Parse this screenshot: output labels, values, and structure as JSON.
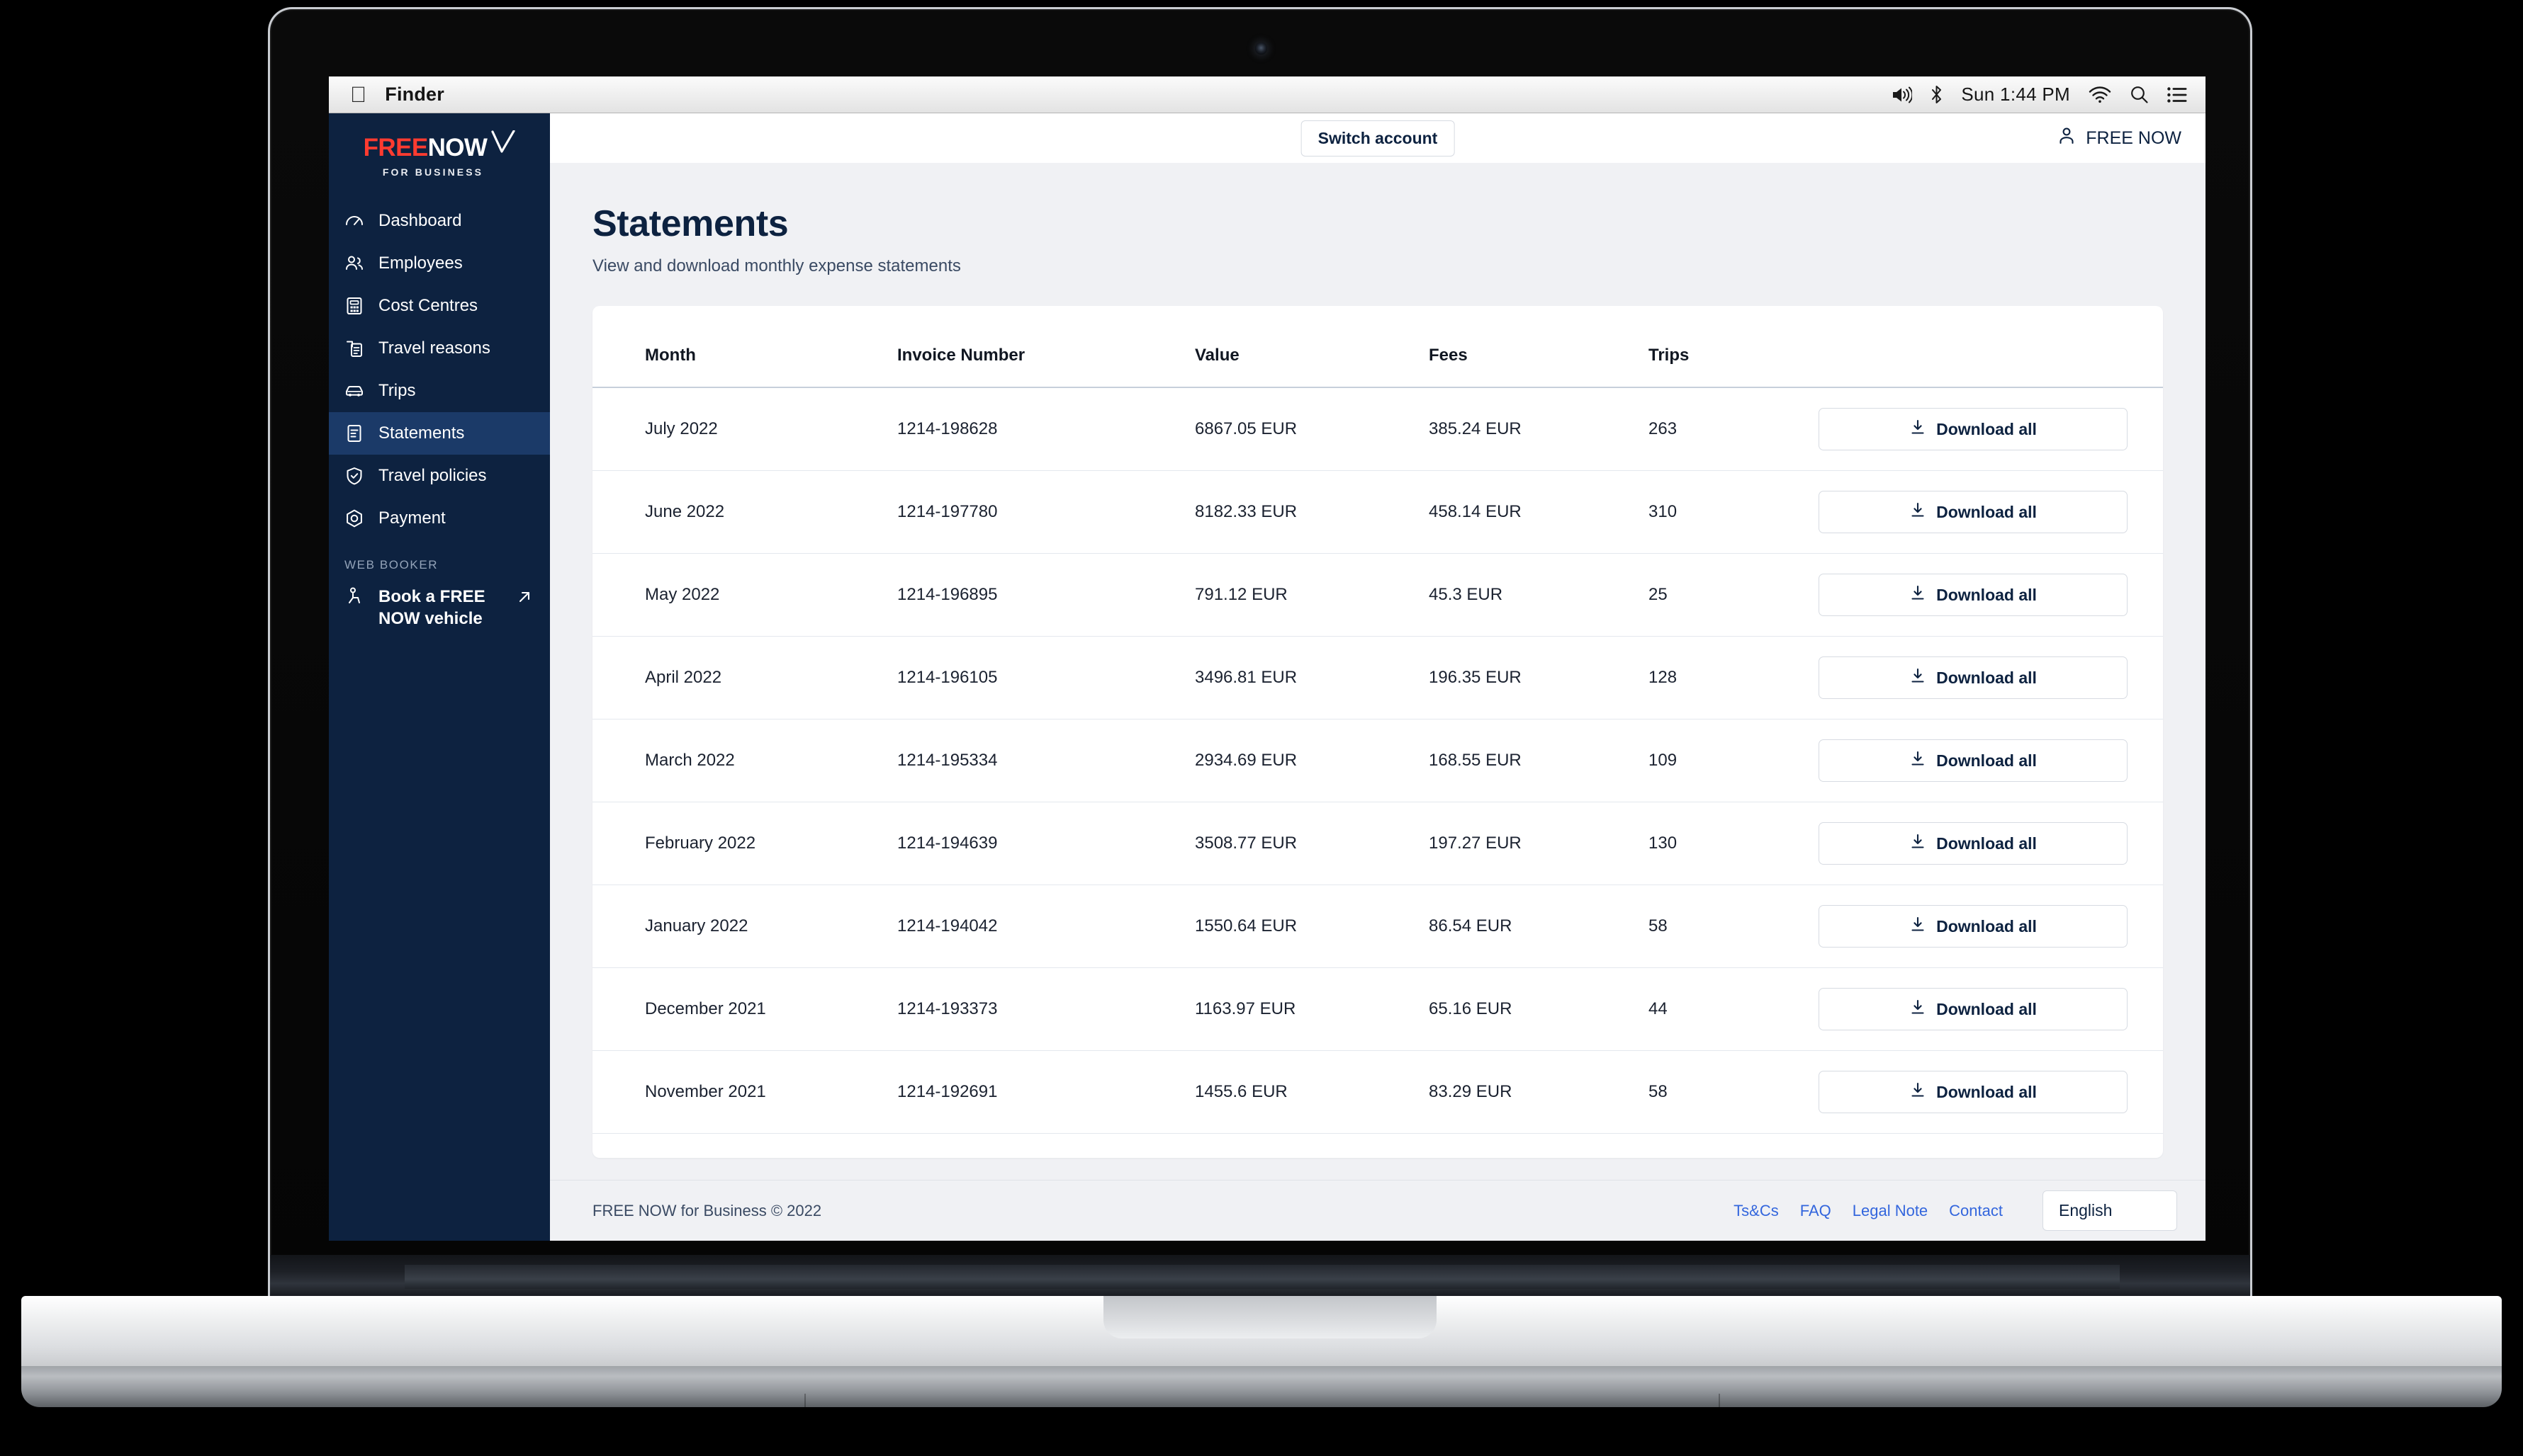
{
  "os_menubar": {
    "apple_icon": "apple-logo",
    "app_name": "Finder",
    "volume_icon": "volume-icon",
    "bluetooth_icon": "bluetooth-icon",
    "clock": "Sun 1:44 PM",
    "wifi_icon": "wifi-icon",
    "search_icon": "search-icon",
    "control_center_icon": "control-center-icon"
  },
  "sidebar": {
    "brand": {
      "free": "FREE",
      "now": "NOW",
      "tagline": "FOR BUSINESS"
    },
    "items": [
      {
        "label": "Dashboard",
        "icon": "speedometer-icon",
        "active": false
      },
      {
        "label": "Employees",
        "icon": "people-icon",
        "active": false
      },
      {
        "label": "Cost Centres",
        "icon": "building-icon",
        "active": false
      },
      {
        "label": "Travel reasons",
        "icon": "clipboard-icon",
        "active": false
      },
      {
        "label": "Trips",
        "icon": "car-icon",
        "active": false
      },
      {
        "label": "Statements",
        "icon": "document-icon",
        "active": true
      },
      {
        "label": "Travel policies",
        "icon": "shield-check-icon",
        "active": false
      },
      {
        "label": "Payment",
        "icon": "circle-target-icon",
        "active": false
      }
    ],
    "section_label": "WEB BOOKER",
    "booker": {
      "label": "Book a FREE NOW vehicle",
      "icon": "person-ride-icon",
      "external_icon": "external-link-icon"
    }
  },
  "topbar": {
    "switch_account_label": "Switch account",
    "account_name": "FREE NOW",
    "account_icon": "person-icon"
  },
  "main": {
    "title": "Statements",
    "subtitle": "View and download monthly expense statements",
    "table": {
      "columns": [
        "Month",
        "Invoice Number",
        "Value",
        "Fees",
        "Trips"
      ],
      "action_label": "Download all",
      "action_icon": "download-icon",
      "rows": [
        {
          "month": "July 2022",
          "invoice": "1214-198628",
          "value": "6867.05 EUR",
          "fees": "385.24 EUR",
          "trips": "263"
        },
        {
          "month": "June 2022",
          "invoice": "1214-197780",
          "value": "8182.33 EUR",
          "fees": "458.14 EUR",
          "trips": "310"
        },
        {
          "month": "May 2022",
          "invoice": "1214-196895",
          "value": "791.12 EUR",
          "fees": "45.3 EUR",
          "trips": "25"
        },
        {
          "month": "April 2022",
          "invoice": "1214-196105",
          "value": "3496.81 EUR",
          "fees": "196.35 EUR",
          "trips": "128"
        },
        {
          "month": "March 2022",
          "invoice": "1214-195334",
          "value": "2934.69 EUR",
          "fees": "168.55 EUR",
          "trips": "109"
        },
        {
          "month": "February 2022",
          "invoice": "1214-194639",
          "value": "3508.77 EUR",
          "fees": "197.27 EUR",
          "trips": "130"
        },
        {
          "month": "January 2022",
          "invoice": "1214-194042",
          "value": "1550.64 EUR",
          "fees": "86.54 EUR",
          "trips": "58"
        },
        {
          "month": "December 2021",
          "invoice": "1214-193373",
          "value": "1163.97 EUR",
          "fees": "65.16 EUR",
          "trips": "44"
        },
        {
          "month": "November 2021",
          "invoice": "1214-192691",
          "value": "1455.6 EUR",
          "fees": "83.29 EUR",
          "trips": "58"
        }
      ]
    }
  },
  "footer": {
    "copyright": "FREE NOW for Business © 2022",
    "links": [
      "Ts&Cs",
      "FAQ",
      "Legal Note",
      "Contact"
    ],
    "language": "English"
  },
  "colors": {
    "brand_red": "#ff3b30",
    "sidebar_navy": "#0d2240",
    "sidebar_active": "#1b3a68",
    "page_bg": "#f0f1f4",
    "link_blue": "#3366dd"
  }
}
